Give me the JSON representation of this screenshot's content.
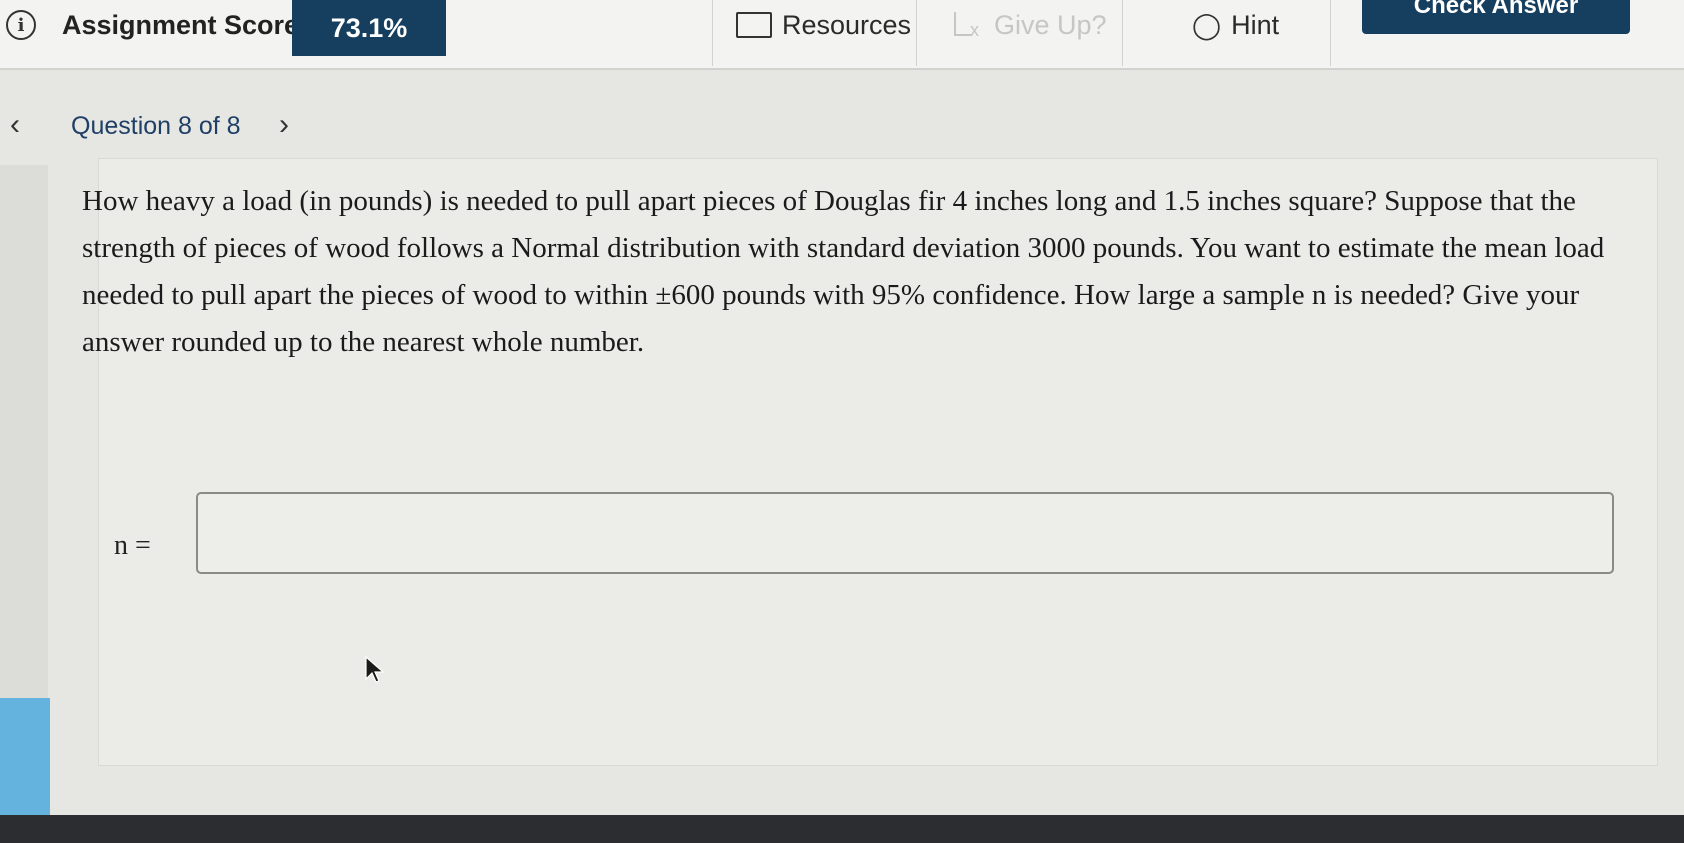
{
  "toolbar": {
    "info_icon": "info-icon",
    "score_label": "Assignment Score:",
    "score_value": "73.1%",
    "resources_label": "Resources",
    "giveup_label": "Give Up?",
    "hint_label": "Hint",
    "check_answer_label": "Check Answer"
  },
  "nav": {
    "question_label": "Question 8 of 8",
    "prev_icon": "chevron-left-icon",
    "next_icon": "chevron-right-icon"
  },
  "question": {
    "text": "How heavy a load (in pounds) is needed to pull apart pieces of Douglas fir 4 inches long and 1.5 inches square? Suppose that the strength of pieces of wood follows a Normal distribution with standard deviation 3000 pounds. You want to estimate the mean load needed to pull apart the pieces of wood to within ±600 pounds with 95% confidence. How large a sample n is needed? Give your answer rounded up to the nearest whole number.",
    "answer_label": "n =",
    "answer_value": ""
  },
  "colors": {
    "brand_navy": "#163e5e",
    "link_blue": "#1f3f66",
    "accent_blue": "#63b3de"
  }
}
